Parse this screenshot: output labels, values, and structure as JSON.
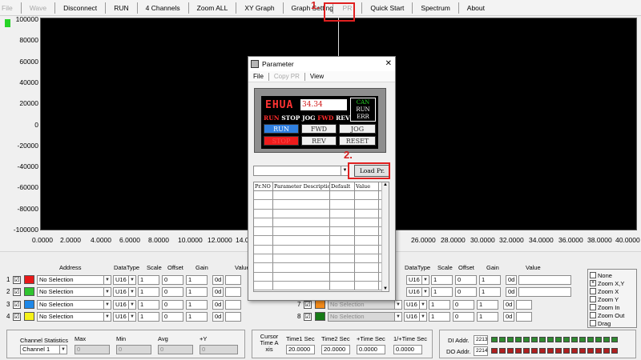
{
  "menubar": [
    "File",
    "Wave",
    "Disconnect",
    "RUN",
    "4 Channels",
    "Zoom ALL",
    "XY Graph",
    "Graph Setting",
    "PR",
    "Quick Start",
    "Spectrum",
    "About"
  ],
  "plot": {
    "y_ticks": [
      "100000",
      "80000",
      "60000",
      "40000",
      "20000",
      "0",
      "-20000",
      "-40000",
      "-60000",
      "-80000",
      "-100000"
    ],
    "x_ticks": [
      "0.0000",
      "2.0000",
      "4.0000",
      "6.0000",
      "8.0000",
      "10.0000",
      "12.0000",
      "14.0",
      "26.0000",
      "28.0000",
      "30.0000",
      "32.0000",
      "34.0000",
      "36.0000",
      "38.0000",
      "40.0000"
    ]
  },
  "channels": {
    "headers": {
      "address": "Address",
      "datatype": "DataType",
      "scale": "Scale",
      "offset": "Offset",
      "gain": "Gain",
      "value": "Value"
    },
    "rows": [
      {
        "num": "1",
        "check": "☑",
        "color": "#e81818",
        "address": "No Selection",
        "type": "U16",
        "scale": "1",
        "offset": "0",
        "gain": "1",
        "fmt": "0d"
      },
      {
        "num": "2",
        "check": "☑",
        "color": "#2fc42f",
        "address": "No Selection",
        "type": "U16",
        "scale": "1",
        "offset": "0",
        "gain": "1",
        "fmt": "0d"
      },
      {
        "num": "3",
        "check": "☑",
        "color": "#1e88e8",
        "address": "No Selection",
        "type": "U16",
        "scale": "1",
        "offset": "0",
        "gain": "1",
        "fmt": "0d"
      },
      {
        "num": "4",
        "check": "☑",
        "color": "#f6f21a",
        "address": "No Selection",
        "type": "U16",
        "scale": "1",
        "offset": "0",
        "gain": "1",
        "fmt": "0d"
      }
    ],
    "rows_right": [
      {
        "num": "7",
        "check": "☑",
        "color": "#f28a1a",
        "address": "No Selection",
        "type": "U16",
        "scale": "1",
        "offset": "0",
        "gain": "1",
        "fmt": "0d"
      },
      {
        "num": "8",
        "check": "☑",
        "color": "#167a16",
        "address": "No Selection",
        "type": "U16",
        "scale": "1",
        "offset": "0",
        "gain": "1",
        "fmt": "0d"
      }
    ],
    "right_rows_upper": [
      {
        "type": "U16",
        "scale": "1",
        "offset": "0",
        "gain": "1",
        "fmt": "0d"
      },
      {
        "type": "U16",
        "scale": "1",
        "offset": "0",
        "gain": "1",
        "fmt": "0d"
      }
    ]
  },
  "zoom_options": [
    {
      "label": "None",
      "mark": ""
    },
    {
      "label": "Zoom X,Y",
      "mark": "×"
    },
    {
      "label": "Zoom X",
      "mark": ""
    },
    {
      "label": "Zoom Y",
      "mark": ""
    },
    {
      "label": "Zoom In",
      "mark": ""
    },
    {
      "label": "Zoom Out",
      "mark": ""
    },
    {
      "label": "Drag",
      "mark": ""
    }
  ],
  "stats": {
    "title": "Channel Statistics",
    "channel": "Channel 1",
    "max_label": "Max",
    "max": "0",
    "min_label": "Min",
    "min": "0",
    "avg_label": "Avg",
    "avg": "0",
    "dy_label": "+Y",
    "dy": "0"
  },
  "cursor": {
    "label": "Cursor Time A xis",
    "time1_label": "Time1 Sec",
    "time1": "20.0000",
    "time2_label": "Time2 Sec",
    "time2": "20.0000",
    "dtime_label": "+Time Sec",
    "dtime": "0.0000",
    "inv_label": "1/+Time Sec",
    "inv": "0.0000"
  },
  "io": {
    "di_label": "DI Addr.",
    "di_addr": "2213",
    "do_label": "DO Addr.",
    "do_addr": "2214",
    "led_on": "#2f8a2f",
    "led_off": "#b02020"
  },
  "dialog": {
    "title": "Parameter",
    "close": "✕",
    "menu": [
      "File",
      "Copy PR",
      "View"
    ],
    "brand": "EHUA",
    "value": "34.34",
    "can": "CAN",
    "run": "RUN",
    "err": "ERR",
    "status": [
      "RUN",
      "STOP",
      "JOG",
      "FWD",
      "REV"
    ],
    "buttons": {
      "run": "RUN",
      "fwd": "FWD",
      "jog": "JOG",
      "stop": "STOP",
      "rev": "REV",
      "reset": "RESET"
    },
    "load_btn": "Load Pr.",
    "table_headers": [
      "Pr.NO",
      "Parameter Description",
      "Default",
      "Value"
    ]
  },
  "callouts": {
    "one": "1.",
    "two": "2."
  }
}
